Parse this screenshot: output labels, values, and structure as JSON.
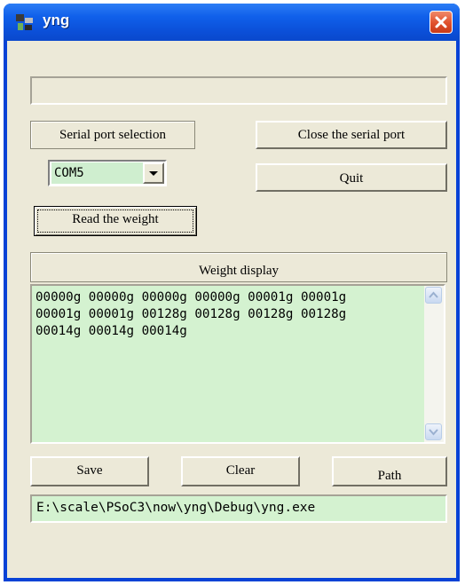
{
  "window": {
    "title": "yng"
  },
  "serial": {
    "selection_label": "Serial port selection",
    "port_value": "COM5",
    "close_label": "Close the serial port",
    "quit_label": "Quit",
    "read_label": "Read the weight"
  },
  "weight": {
    "display_label": "Weight display",
    "readings": "00000g 00000g 00000g 00000g 00001g 00001g\n00001g 00001g 00128g 00128g 00128g 00128g\n00014g 00014g 00014g"
  },
  "actions": {
    "save_label": "Save",
    "clear_label": "Clear",
    "path_label": "Path"
  },
  "path_value": "E:\\scale\\PSoC3\\now\\yng\\Debug\\yng.exe",
  "colors": {
    "titlebar": "#0b4fd8",
    "field_green": "#d4f2d0",
    "close_red": "#e0502c",
    "dialog": "#ece9d8"
  },
  "icons": {
    "app": "scale-icon",
    "close": "close-icon",
    "dropdown": "chevron-down-icon",
    "scroll_up": "scroll-up-icon",
    "scroll_down": "scroll-down-icon"
  }
}
